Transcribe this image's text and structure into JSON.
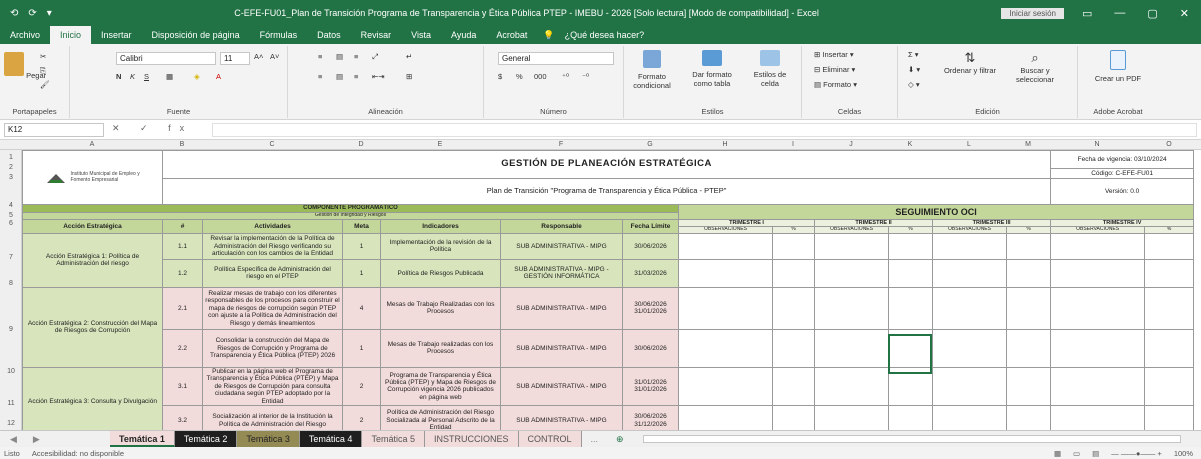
{
  "window": {
    "quick_access": [
      "⟲",
      "⟳",
      "▾"
    ],
    "title": "C-EFE-FU01_Plan de Transición Programa de Transparencia y Ética Pública PTEP - IMEBU - 2026 [Solo lectura] [Modo de compatibilidad] - Excel",
    "user": "Iniciar sesión",
    "controls": [
      "▭",
      "—",
      "▢",
      "✕"
    ]
  },
  "menu": {
    "tabs": [
      "Archivo",
      "Inicio",
      "Insertar",
      "Disposición de página",
      "Fórmulas",
      "Datos",
      "Revisar",
      "Vista",
      "Ayuda",
      "Acrobat"
    ],
    "active": "Inicio",
    "tell_me": "¿Qué desea hacer?"
  },
  "ribbon": {
    "clipboard": {
      "paste": "Pegar",
      "label": "Portapapeles"
    },
    "font": {
      "name": "Calibri",
      "size": "11",
      "label": "Fuente"
    },
    "alignment": {
      "label": "Alineación"
    },
    "number": {
      "format": "General",
      "label": "Número"
    },
    "styles": {
      "conditional": "Formato condicional",
      "as_table": "Dar formato como tabla",
      "cell_styles": "Estilos de celda",
      "label": "Estilos"
    },
    "cells": {
      "insert": "Insertar",
      "delete": "Eliminar",
      "format": "Formato",
      "label": "Celdas"
    },
    "editing": {
      "sort": "Ordenar y filtrar",
      "find": "Buscar y seleccionar",
      "label": "Edición"
    },
    "acrobat": {
      "create": "Crear un PDF",
      "label": "Adobe Acrobat"
    }
  },
  "formula_bar": {
    "name_box": "K12",
    "fx": "✕ ✓ fx",
    "value": ""
  },
  "columns": [
    "A",
    "B",
    "C",
    "D",
    "E",
    "F",
    "G",
    "H",
    "I",
    "J",
    "K",
    "L",
    "M",
    "N",
    "O"
  ],
  "rows": [
    "1",
    "2",
    "3",
    "4",
    "5",
    "6",
    "7",
    "8",
    "9",
    "10",
    "11",
    "12",
    "13"
  ],
  "sheet": {
    "org_name": "Instituto Municipal de Empleo y Fomento Empresarial",
    "title": "GESTIÓN DE PLANEACIÓN ESTRATÉGICA",
    "subtitle": "Plan de Transición \"Programa de Transparencia y Ética Pública - PTEP\"",
    "meta": [
      "Fecha de vigencia: 03/10/2024",
      "Código: C-EFE-FU01",
      "Versión: 0.0"
    ],
    "component": "COMPONENTE PROGRAMÁTICO",
    "component_sub": "Gestión de Integridad y Riesgos",
    "headers": [
      "Acción Estratégica",
      "#",
      "Actividades",
      "Meta",
      "Indicadores",
      "Responsable",
      "Fecha Límite"
    ],
    "followup": "SEGUIMIENTO OCI",
    "trimesters": [
      "TRIMESTRE I",
      "TRIMESTRE II",
      "TRIMESTRE III",
      "TRIMESTRE IV"
    ],
    "obs_label": "OBSERVACIONES",
    "pct_label": "%",
    "groups": [
      {
        "action": "Acción Estratégica 1: Política de Administración del riesgo",
        "rows": [
          {
            "num": "1.1",
            "activity": "Revisar la implementación de la Política de Administración del Riesgo verificando su articulación con los cambios de la Entidad",
            "meta": "1",
            "indicator": "Implementación de la revisión de la Política",
            "resp": "SUB ADMINISTRATIVA - MIPG",
            "date": "30/06/2026"
          },
          {
            "num": "1.2",
            "activity": "Política Específica de Administración del riesgo en el PTEP",
            "meta": "1",
            "indicator": "Política de Riesgos Publicada",
            "resp": "SUB ADMINISTRATIVA - MIPG - GESTIÓN INFORMÁTICA",
            "date": "31/03/2026"
          }
        ]
      },
      {
        "action": "Acción Estratégica 2: Construcción del Mapa de Riesgos de Corrupción",
        "rows": [
          {
            "num": "2.1",
            "activity": "Realizar mesas de trabajo con los diferentes responsables de los procesos para construir el mapa de riesgos de corrupción según PTEP con ajuste a la Política de Administración del Riesgo y demás lineamientos",
            "meta": "4",
            "indicator": "Mesas de Trabajo Realizadas con los Procesos",
            "resp": "SUB ADMINISTRATIVA - MIPG",
            "date": "30/06/2026 31/01/2026"
          },
          {
            "num": "2.2",
            "activity": "Consolidar la construcción del Mapa de Riesgos de Corrupción y Programa de Transparencia y Ética Pública (PTEP) 2026",
            "meta": "1",
            "indicator": "Mesas de Trabajo realizadas con los Procesos",
            "resp": "SUB ADMINISTRATIVA - MIPG",
            "date": "30/06/2026"
          }
        ]
      },
      {
        "action": "Acción Estratégica 3: Consulta y Divulgación",
        "rows": [
          {
            "num": "3.1",
            "activity": "Publicar en la página web el Programa de Transparencia y Ética Pública (PTEP) y Mapa de Riesgos de Corrupción para consulta ciudadana según PTEP adoptado por la Entidad",
            "meta": "2",
            "indicator": "Programa de Transparencia y Ética Pública (PTEP) y Mapa de Riesgos de Corrupción vigencia 2026 publicados en página web",
            "resp": "SUB ADMINISTRATIVA - MIPG",
            "date": "31/01/2026 31/01/2026"
          },
          {
            "num": "3.2",
            "activity": "Socialización al interior de la Institución la Política de Administración del Riesgo",
            "meta": "2",
            "indicator": "Política de Administración del Riesgo Socializada al Personal Adscrito de la Entidad",
            "resp": "SUB ADMINISTRATIVA - MIPG",
            "date": "30/06/2026 31/12/2026"
          }
        ]
      }
    ]
  },
  "sheet_tabs": {
    "nav": [
      "◀",
      "▶"
    ],
    "tabs": [
      "Temática 1",
      "Temática 2",
      "Temática 3",
      "Temática 4",
      "Temática 5",
      "INSTRUCCIONES",
      "CONTROL"
    ],
    "tab_colors": [
      "#f2dcdb",
      "#1f1f1f",
      "#948a54",
      "#1f1f1f",
      "#f2dcdb",
      "#f2dcdb",
      "#f2dcdb"
    ],
    "tab_text_colors": [
      "#222",
      "#fff",
      "#222",
      "#fff",
      "#555",
      "#555",
      "#555"
    ],
    "active": "Temática 1",
    "more": "...",
    "add": "⊕"
  },
  "status": {
    "ready": "Listo",
    "accessibility": "Accesibilidad: no disponible",
    "zoom": "100%"
  }
}
